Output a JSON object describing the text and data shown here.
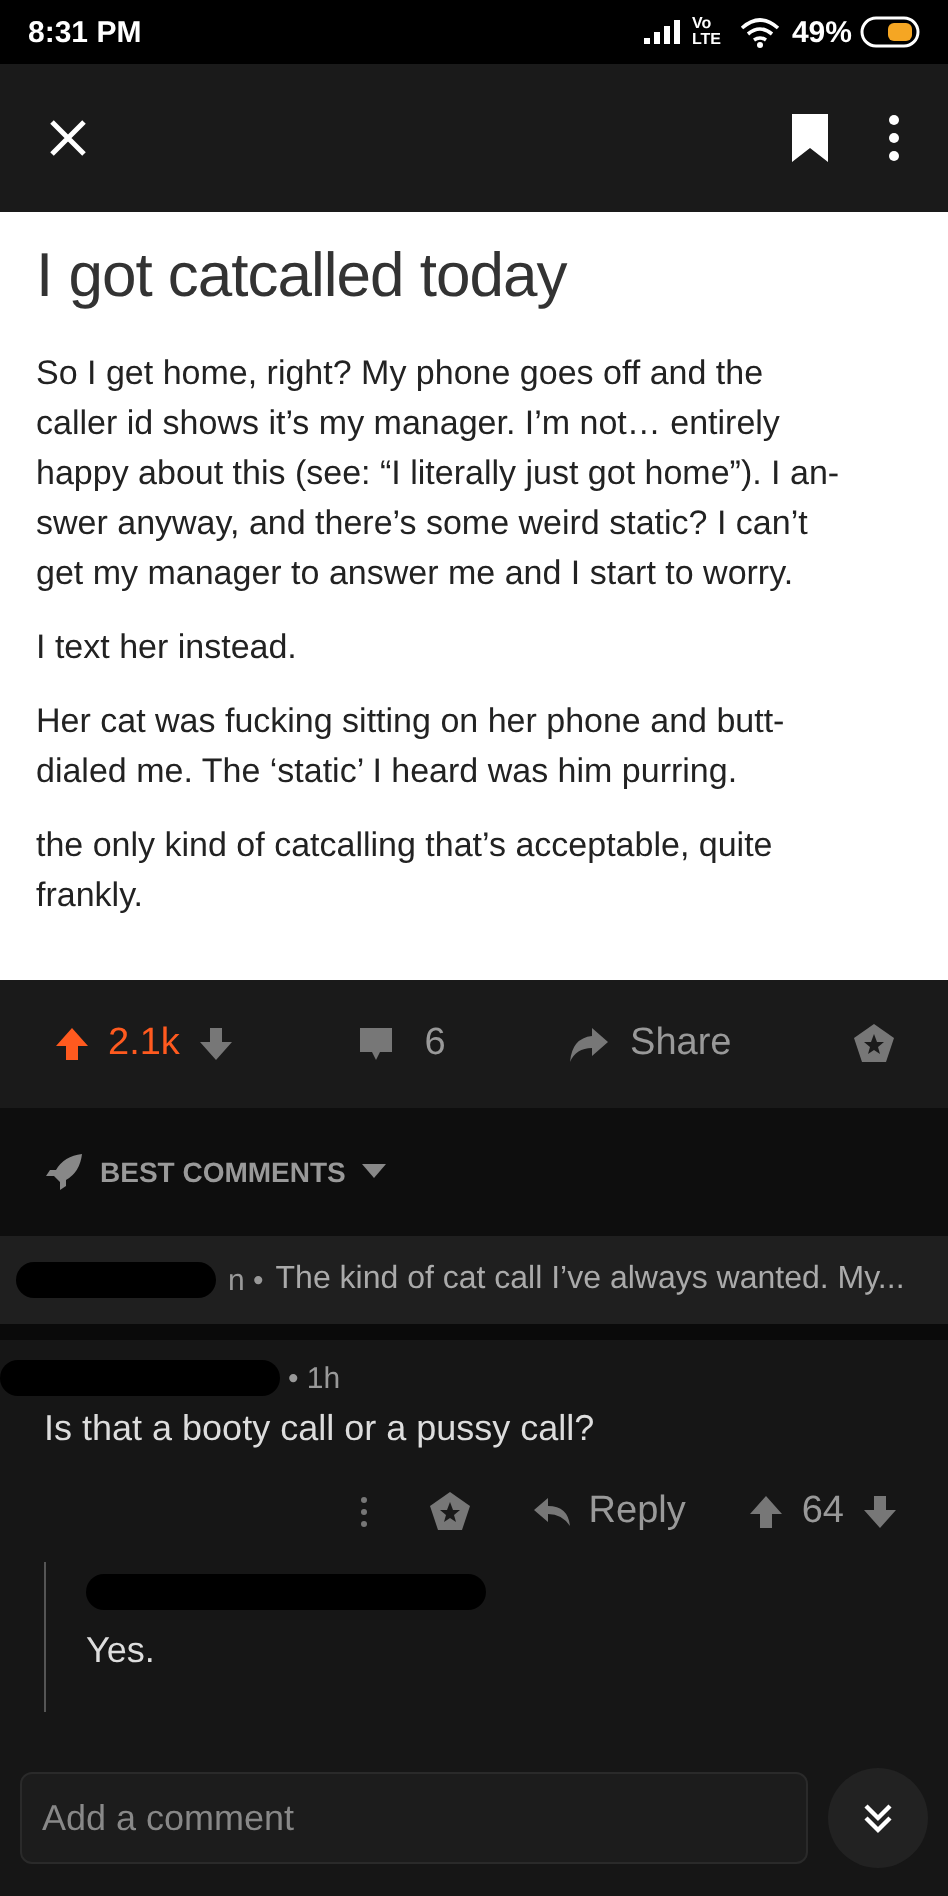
{
  "status_bar": {
    "time": "8:31 PM",
    "network": "Vo LTE",
    "battery": "49%"
  },
  "post": {
    "title": "I got catcalled today",
    "paragraphs": [
      "So I get home, right? My phone goes off and the caller id shows it’s my manager. I’m not… entirely happy about this (see: “I literally just got home”). I an-swer anyway, and there’s some weird static? I can’t get my manager to answer me and I start to worry.",
      "I text her instead.",
      "Her cat was fucking sitting on her phone and butt-dialed me. The ‘static’ I heard was him purring.",
      "the only kind of catcalling that’s acceptable, quite frankly."
    ]
  },
  "actions": {
    "score": "2.1k",
    "upvoted": true,
    "comments": "6",
    "share": "Share"
  },
  "sort": {
    "label": "BEST COMMENTS"
  },
  "comments": [
    {
      "kind": "collapsed",
      "meta": "n •",
      "text": "The kind of cat call I’ve always wanted. My..."
    },
    {
      "kind": "full",
      "meta": "• 1h",
      "text": "Is that a booty call or a pussy call?",
      "reply": "Reply",
      "score": "64",
      "replies": [
        {
          "text": "Yes."
        }
      ]
    }
  ],
  "composer": {
    "placeholder": "Add a comment"
  }
}
